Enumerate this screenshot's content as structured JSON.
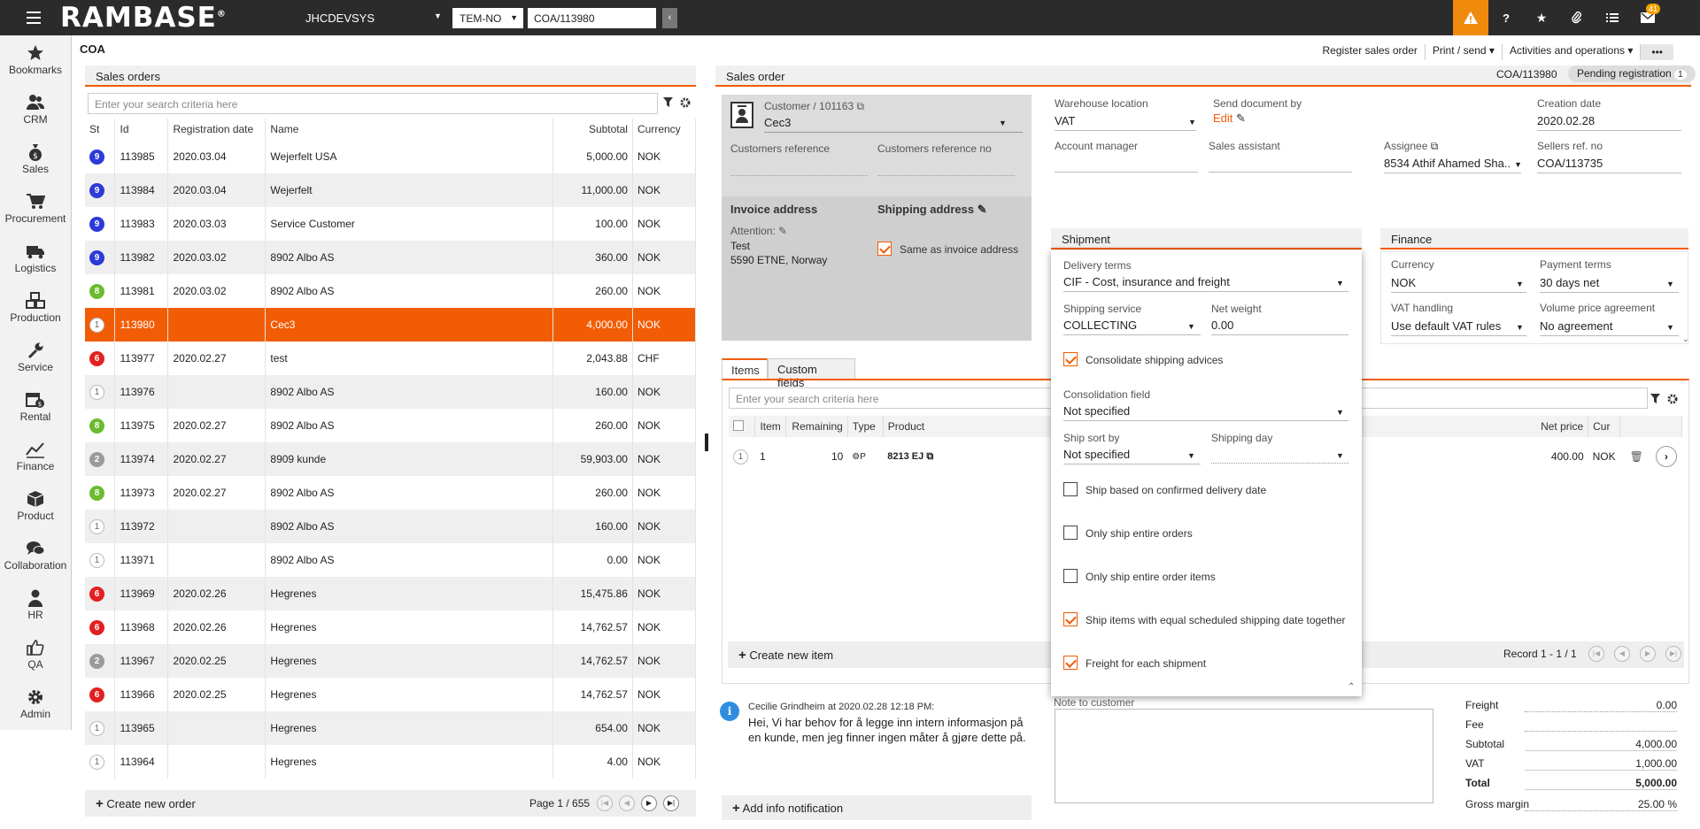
{
  "topbar": {
    "logo": "RAMBASE",
    "logo_mark": "®",
    "system": "JHCDEVSYS",
    "company": "TEM-NO",
    "search_value": "COA/113980",
    "notifications_count": "41"
  },
  "nav": [
    {
      "label": "Bookmarks",
      "icon": "star-icon"
    },
    {
      "label": "CRM",
      "icon": "people-icon"
    },
    {
      "label": "Sales",
      "icon": "money-bag-icon"
    },
    {
      "label": "Procurement",
      "icon": "cart-icon"
    },
    {
      "label": "Logistics",
      "icon": "truck-icon"
    },
    {
      "label": "Production",
      "icon": "boxes-icon"
    },
    {
      "label": "Service",
      "icon": "wrench-icon"
    },
    {
      "label": "Rental",
      "icon": "calendar-money-icon"
    },
    {
      "label": "Finance",
      "icon": "chart-line-icon"
    },
    {
      "label": "Product",
      "icon": "box-icon"
    },
    {
      "label": "Collaboration",
      "icon": "chat-icon"
    },
    {
      "label": "HR",
      "icon": "person-icon"
    },
    {
      "label": "QA",
      "icon": "thumbs-up-icon"
    },
    {
      "label": "Admin",
      "icon": "gear-icon"
    }
  ],
  "breadcrumb": "COA",
  "actions": {
    "register": "Register sales order",
    "print": "Print / send",
    "activities": "Activities and operations",
    "more": "•••"
  },
  "orders": {
    "title": "Sales orders",
    "search_placeholder": "Enter your search criteria here",
    "columns": [
      "St",
      "Id",
      "Registration date",
      "Name",
      "Subtotal",
      "Currency"
    ],
    "rows": [
      {
        "st": "9",
        "color": "blue",
        "id": "113985",
        "date": "2020.03.04",
        "name": "Wejerfelt USA",
        "subtotal": "5,000.00",
        "cur": "NOK"
      },
      {
        "st": "9",
        "color": "blue",
        "id": "113984",
        "date": "2020.03.04",
        "name": "Wejerfelt",
        "subtotal": "11,000.00",
        "cur": "NOK"
      },
      {
        "st": "9",
        "color": "blue",
        "id": "113983",
        "date": "2020.03.03",
        "name": "Service Customer",
        "subtotal": "100.00",
        "cur": "NOK"
      },
      {
        "st": "9",
        "color": "blue",
        "id": "113982",
        "date": "2020.03.02",
        "name": "8902 Albo AS",
        "subtotal": "360.00",
        "cur": "NOK"
      },
      {
        "st": "8",
        "color": "green",
        "id": "113981",
        "date": "2020.03.02",
        "name": "8902 Albo AS",
        "subtotal": "260.00",
        "cur": "NOK"
      },
      {
        "st": "1",
        "color": "white",
        "id": "113980",
        "date": "",
        "name": "Cec3",
        "subtotal": "4,000.00",
        "cur": "NOK",
        "selected": true
      },
      {
        "st": "6",
        "color": "red",
        "id": "113977",
        "date": "2020.02.27",
        "name": "test",
        "subtotal": "2,043.88",
        "cur": "CHF"
      },
      {
        "st": "1",
        "color": "white",
        "id": "113976",
        "date": "",
        "name": "8902 Albo AS",
        "subtotal": "160.00",
        "cur": "NOK"
      },
      {
        "st": "8",
        "color": "green",
        "id": "113975",
        "date": "2020.02.27",
        "name": "8902 Albo AS",
        "subtotal": "260.00",
        "cur": "NOK"
      },
      {
        "st": "2",
        "color": "grey",
        "id": "113974",
        "date": "2020.02.27",
        "name": "8909 kunde",
        "subtotal": "59,903.00",
        "cur": "NOK"
      },
      {
        "st": "8",
        "color": "green",
        "id": "113973",
        "date": "2020.02.27",
        "name": "8902 Albo AS",
        "subtotal": "260.00",
        "cur": "NOK"
      },
      {
        "st": "1",
        "color": "white",
        "id": "113972",
        "date": "",
        "name": "8902 Albo AS",
        "subtotal": "160.00",
        "cur": "NOK"
      },
      {
        "st": "1",
        "color": "white",
        "id": "113971",
        "date": "",
        "name": "8902 Albo AS",
        "subtotal": "0.00",
        "cur": "NOK"
      },
      {
        "st": "6",
        "color": "red",
        "id": "113969",
        "date": "2020.02.26",
        "name": "Hegrenes",
        "subtotal": "15,475.86",
        "cur": "NOK"
      },
      {
        "st": "6",
        "color": "red",
        "id": "113968",
        "date": "2020.02.26",
        "name": "Hegrenes",
        "subtotal": "14,762.57",
        "cur": "NOK"
      },
      {
        "st": "2",
        "color": "grey",
        "id": "113967",
        "date": "2020.02.25",
        "name": "Hegrenes",
        "subtotal": "14,762.57",
        "cur": "NOK"
      },
      {
        "st": "6",
        "color": "red",
        "id": "113966",
        "date": "2020.02.25",
        "name": "Hegrenes",
        "subtotal": "14,762.57",
        "cur": "NOK"
      },
      {
        "st": "1",
        "color": "white",
        "id": "113965",
        "date": "",
        "name": "Hegrenes",
        "subtotal": "654.00",
        "cur": "NOK"
      },
      {
        "st": "1",
        "color": "white",
        "id": "113964",
        "date": "",
        "name": "Hegrenes",
        "subtotal": "4.00",
        "cur": "NOK"
      }
    ],
    "create": "Create new order",
    "page": "Page 1 / 655"
  },
  "so": {
    "title": "Sales order",
    "id": "COA/113980",
    "status": "Pending registration",
    "status_count": "1",
    "customer_label": "Customer / 101163",
    "customer": "Cec3",
    "cust_ref_label": "Customers reference",
    "cust_ref_no_label": "Customers reference no",
    "invoice_label": "Invoice address",
    "shipping_label": "Shipping address",
    "attention_label": "Attention:",
    "addr1": "Test",
    "addr2": "5590 ETNE, Norway",
    "same_label": "Same as invoice address",
    "warehouse_label": "Warehouse location",
    "warehouse": "VAT",
    "send_doc_label": "Send document by",
    "send_doc": "Edit",
    "creation_label": "Creation date",
    "creation": "2020.02.28",
    "account_mgr_label": "Account manager",
    "sales_asst_label": "Sales assistant",
    "assignee_label": "Assignee",
    "assignee": "8534 Athif Ahamed Sha..",
    "sellers_ref_label": "Sellers ref. no",
    "sellers_ref": "COA/113735"
  },
  "shipment": {
    "title": "Shipment",
    "delivery_terms_label": "Delivery terms",
    "delivery_terms": "CIF - Cost, insurance and freight",
    "shipping_service_label": "Shipping service",
    "shipping_service": "COLLECTING",
    "net_weight_label": "Net weight",
    "net_weight": "0.00",
    "consolidate": "Consolidate shipping advices",
    "consolidation_field_label": "Consolidation field",
    "consolidation_field": "Not specified",
    "ship_sort_label": "Ship sort by",
    "ship_sort": "Not specified",
    "shipping_day_label": "Shipping day",
    "cb1": "Ship based on confirmed delivery date",
    "cb2": "Only ship entire orders",
    "cb3": "Only ship entire order items",
    "cb4": "Ship items with equal scheduled shipping date together",
    "cb5": "Freight for each shipment"
  },
  "finance": {
    "title": "Finance",
    "currency_label": "Currency",
    "currency": "NOK",
    "payment_label": "Payment terms",
    "payment": "30 days net",
    "vat_label": "VAT handling",
    "vat": "Use default VAT rules",
    "volume_label": "Volume price agreement",
    "volume": "No agreement"
  },
  "items": {
    "tab1": "Items",
    "tab2": "Custom fields",
    "search_placeholder": "Enter your search criteria here",
    "columns": [
      "Item",
      "Remaining",
      "Type",
      "Product",
      "Net price",
      "Cur"
    ],
    "row": {
      "st": "1",
      "item": "1",
      "remaining": "10",
      "type": "P",
      "product": "8213 EJ",
      "net_price": "400.00",
      "cur": "NOK"
    },
    "create": "Create new item",
    "record": "Record 1 - 1 / 1"
  },
  "note": {
    "author": "Cecilie Grindheim at 2020.02.28 12:18 PM:",
    "text": "Hei,  Vi har behov for å legge inn intern informasjon på en kunde, men jeg finner ingen måter å gjøre dette på.",
    "add": "Add info notification",
    "note_label": "Note to customer"
  },
  "totals": {
    "freight_label": "Freight",
    "freight": "0.00",
    "fee_label": "Fee",
    "fee": "",
    "subtotal_label": "Subtotal",
    "subtotal": "4,000.00",
    "vat_label": "VAT",
    "vat": "1,000.00",
    "total_label": "Total",
    "total": "5,000.00",
    "margin_label": "Gross margin",
    "margin": "25.00 %"
  }
}
